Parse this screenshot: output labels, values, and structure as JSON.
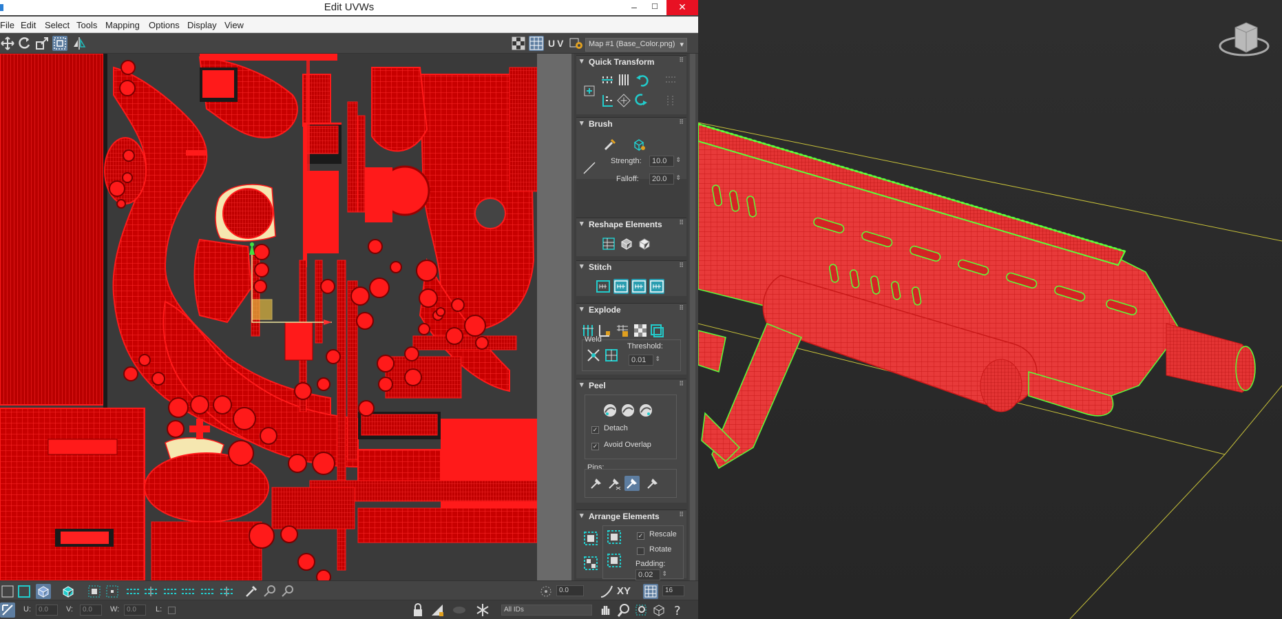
{
  "window": {
    "title": "Edit UVWs",
    "minimize": "–",
    "maximize": "☐",
    "close": "✕"
  },
  "menu": [
    "File",
    "Edit",
    "Select",
    "Tools",
    "Mapping",
    "Options",
    "Display",
    "View"
  ],
  "toolbar": {
    "uv_label": "UV",
    "map_select": "Map #1 (Base_Color.png)"
  },
  "panel": {
    "quick_transform": {
      "title": "Quick Transform"
    },
    "brush": {
      "title": "Brush",
      "strength_label": "Strength:",
      "strength_value": "10.0",
      "falloff_label": "Falloff:",
      "falloff_value": "20.0"
    },
    "reshape": {
      "title": "Reshape Elements"
    },
    "stitch": {
      "title": "Stitch"
    },
    "explode": {
      "title": "Explode",
      "weld_label": "Weld",
      "threshold_label": "Threshold:",
      "threshold_value": "0.01"
    },
    "peel": {
      "title": "Peel",
      "detach_label": "Detach",
      "detach_checked": "✓",
      "avoid_overlap_label": "Avoid Overlap",
      "avoid_overlap_checked": "✓",
      "pins_label": "Pins:"
    },
    "arrange": {
      "title": "Arrange Elements",
      "rescale_label": "Rescale",
      "rescale_checked": "✓",
      "rotate_label": "Rotate",
      "padding_label": "Padding:",
      "padding_value": "0.02"
    }
  },
  "bottom": {
    "angle_value": "0.0",
    "xy_label": "XY",
    "grid_value": "16",
    "u_label": "U:",
    "u_value": "0.0",
    "v_label": "V:",
    "v_value": "0.0",
    "w_label": "W:",
    "w_value": "0.0",
    "l_label": "L:",
    "ids_select": "All IDs"
  },
  "colors": {
    "uv_red": "#ff1a1a",
    "mesh_green": "#5cff3a",
    "bbox_yellow": "#e6e05a",
    "selected_cream": "#f5e7b0"
  }
}
